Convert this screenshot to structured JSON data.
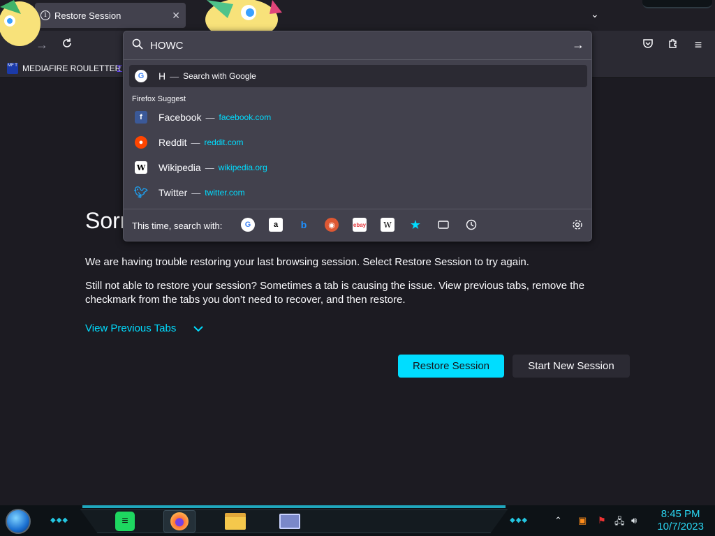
{
  "browser": {
    "tab": {
      "title": "Restore Session"
    },
    "bookmarks": [
      {
        "label": "MEDIAFIRE ROULETTER",
        "icon_text": "MF T"
      }
    ]
  },
  "urlbar": {
    "value": "HOWC",
    "heuristic": {
      "title": "H",
      "action": "Search with Google"
    },
    "group_label": "Firefox Suggest",
    "suggestions": [
      {
        "title": "Facebook",
        "url": "facebook.com",
        "icon": "facebook-icon"
      },
      {
        "title": "Reddit",
        "url": "reddit.com",
        "icon": "reddit-icon"
      },
      {
        "title": "Wikipedia",
        "url": "wikipedia.org",
        "icon": "wikipedia-icon"
      },
      {
        "title": "Twitter",
        "url": "twitter.com",
        "icon": "twitter-icon"
      }
    ],
    "search_with_label": "This time, search with:",
    "engines": [
      "google-icon",
      "amazon-icon",
      "bing-icon",
      "duckduckgo-icon",
      "ebay-icon",
      "wikipedia-icon",
      "bookmarks-icon",
      "tabs-icon",
      "history-icon"
    ]
  },
  "page": {
    "heading": "Sorr",
    "paragraph1": "We are having trouble restoring your last browsing session. Select Restore Session to try again.",
    "paragraph2": "Still not able to restore your session? Sometimes a tab is causing the issue. View previous tabs, remove the checkmark from the tabs you don’t need to recover, and then restore.",
    "view_previous": "View Previous Tabs",
    "restore_button": "Restore Session",
    "new_session_button": "Start New Session"
  },
  "taskbar": {
    "time": "8:45 PM",
    "date": "10/7/2023"
  },
  "colors": {
    "accent": "#00ddff",
    "panel": "#42414d",
    "background": "#1c1b22"
  }
}
